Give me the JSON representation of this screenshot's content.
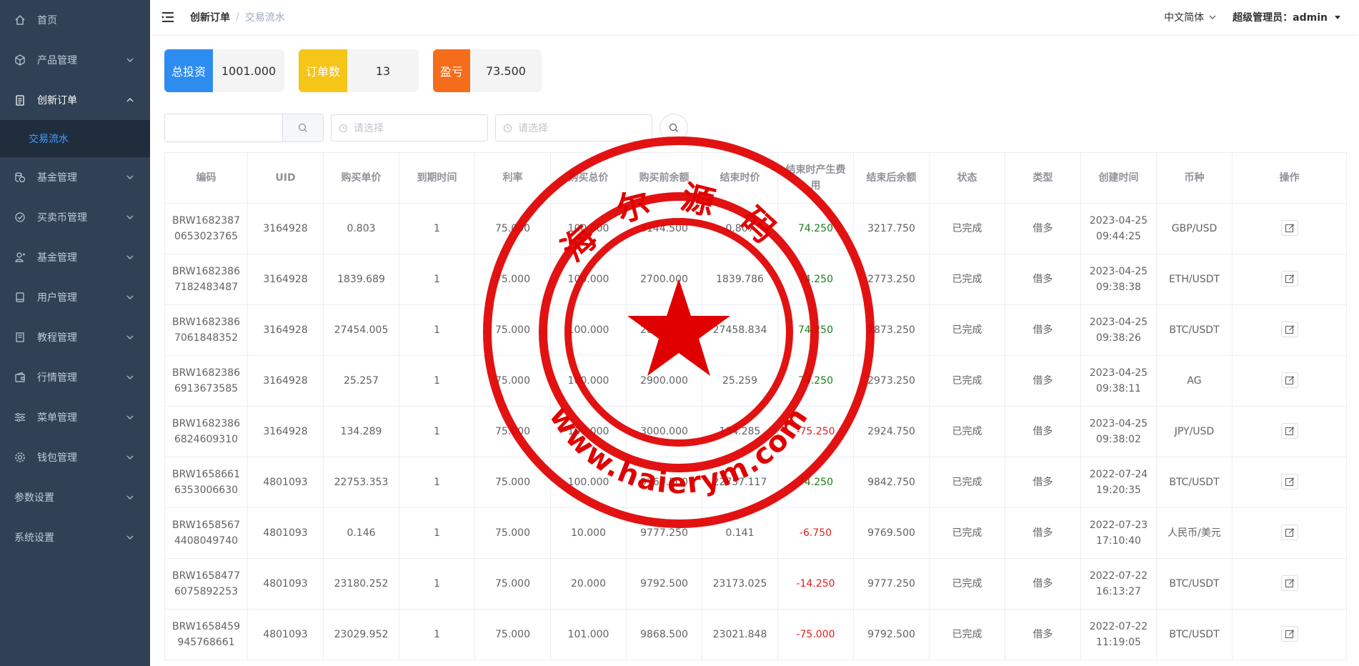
{
  "sidebar": {
    "items": [
      {
        "label": "首页",
        "icon": "home-icon",
        "chevron": false
      },
      {
        "label": "产品管理",
        "icon": "cube-icon",
        "chevron": true
      },
      {
        "label": "创新订单",
        "icon": "clipboard-icon",
        "chevron": true,
        "open": true
      },
      {
        "label": "基金管理",
        "icon": "coins-icon",
        "chevron": true
      },
      {
        "label": "买卖币管理",
        "icon": "exchange-icon",
        "chevron": true
      },
      {
        "label": "基金管理",
        "icon": "user-plus-icon",
        "chevron": true
      },
      {
        "label": "用户管理",
        "icon": "device-icon",
        "chevron": true
      },
      {
        "label": "教程管理",
        "icon": "book-icon",
        "chevron": true
      },
      {
        "label": "行情管理",
        "icon": "wallet-icon",
        "chevron": true
      },
      {
        "label": "菜单管理",
        "icon": "sliders-icon",
        "chevron": true
      },
      {
        "label": "钱包管理",
        "icon": "gear-icon",
        "chevron": true
      },
      {
        "label": "参数设置",
        "icon": "",
        "chevron": true
      },
      {
        "label": "系统设置",
        "icon": "",
        "chevron": true
      }
    ],
    "sub_item": "交易流水"
  },
  "header": {
    "breadcrumb_1": "创新订单",
    "breadcrumb_sep": "/",
    "breadcrumb_2": "交易流水",
    "language": "中文简体",
    "user": "超级管理员：admin"
  },
  "stats": [
    {
      "label": "总投资",
      "value": "1001.000",
      "color": "#2d8cf0"
    },
    {
      "label": "订单数",
      "value": "13",
      "color": "#f5c518"
    },
    {
      "label": "盈亏",
      "value": "73.500",
      "color": "#f56c1a"
    }
  ],
  "filters": {
    "search_value": "",
    "start_placeholder": "请选择",
    "end_placeholder": "请选择"
  },
  "table": {
    "columns": [
      "编码",
      "UID",
      "购买单价",
      "到期时间",
      "利率",
      "购买总价",
      "购买前余额",
      "结束时价",
      "结束时产生费用",
      "结束后余额",
      "状态",
      "类型",
      "创建时间",
      "币种",
      "操作"
    ],
    "rows": [
      {
        "code": "BRW16823870653023765",
        "uid": "3164928",
        "price": "0.803",
        "expire": "1",
        "rate": "75.000",
        "total": "100.000",
        "before": "3144.500",
        "end_price": "0.807",
        "fee": "74.250",
        "fee_sign": "pos",
        "after": "3217.750",
        "status": "已完成",
        "type": "借多",
        "created": "2023-04-25 09:44:25",
        "currency": "GBP/USD"
      },
      {
        "code": "BRW16823867182483487",
        "uid": "3164928",
        "price": "1839.689",
        "expire": "1",
        "rate": "75.000",
        "total": "100.000",
        "before": "2700.000",
        "end_price": "1839.786",
        "fee": "74.250",
        "fee_sign": "pos",
        "after": "2773.250",
        "status": "已完成",
        "type": "借多",
        "created": "2023-04-25 09:38:38",
        "currency": "ETH/USDT"
      },
      {
        "code": "BRW16823867061848352",
        "uid": "3164928",
        "price": "27454.005",
        "expire": "1",
        "rate": "75.000",
        "total": "100.000",
        "before": "2800.000",
        "end_price": "27458.834",
        "fee": "74.250",
        "fee_sign": "pos",
        "after": "2873.250",
        "status": "已完成",
        "type": "借多",
        "created": "2023-04-25 09:38:26",
        "currency": "BTC/USDT"
      },
      {
        "code": "BRW16823866913673585",
        "uid": "3164928",
        "price": "25.257",
        "expire": "1",
        "rate": "75.000",
        "total": "100.000",
        "before": "2900.000",
        "end_price": "25.259",
        "fee": "74.250",
        "fee_sign": "pos",
        "after": "2973.250",
        "status": "已完成",
        "type": "借多",
        "created": "2023-04-25 09:38:11",
        "currency": "AG"
      },
      {
        "code": "BRW16823866824609310",
        "uid": "3164928",
        "price": "134.289",
        "expire": "1",
        "rate": "75.000",
        "total": "100.000",
        "before": "3000.000",
        "end_price": "134.285",
        "fee": "-75.250",
        "fee_sign": "neg",
        "after": "2924.750",
        "status": "已完成",
        "type": "借多",
        "created": "2023-04-25 09:38:02",
        "currency": "JPY/USD"
      },
      {
        "code": "BRW16586616353006630",
        "uid": "4801093",
        "price": "22753.353",
        "expire": "1",
        "rate": "75.000",
        "total": "100.000",
        "before": "9769.500",
        "end_price": "22757.117",
        "fee": "74.250",
        "fee_sign": "pos",
        "after": "9842.750",
        "status": "已完成",
        "type": "借多",
        "created": "2022-07-24 19:20:35",
        "currency": "BTC/USDT"
      },
      {
        "code": "BRW16585674408049740",
        "uid": "4801093",
        "price": "0.146",
        "expire": "1",
        "rate": "75.000",
        "total": "10.000",
        "before": "9777.250",
        "end_price": "0.141",
        "fee": "-6.750",
        "fee_sign": "neg",
        "after": "9769.500",
        "status": "已完成",
        "type": "借多",
        "created": "2022-07-23 17:10:40",
        "currency": "人民币/美元"
      },
      {
        "code": "BRW16584776075892253",
        "uid": "4801093",
        "price": "23180.252",
        "expire": "1",
        "rate": "75.000",
        "total": "20.000",
        "before": "9792.500",
        "end_price": "23173.025",
        "fee": "-14.250",
        "fee_sign": "neg",
        "after": "9777.250",
        "status": "已完成",
        "type": "借多",
        "created": "2022-07-22 16:13:27",
        "currency": "BTC/USDT"
      },
      {
        "code": "BRW1658459945768661",
        "uid": "4801093",
        "price": "23029.952",
        "expire": "1",
        "rate": "75.000",
        "total": "101.000",
        "before": "9868.500",
        "end_price": "23021.848",
        "fee": "-75.000",
        "fee_sign": "neg",
        "after": "9792.500",
        "status": "已完成",
        "type": "借多",
        "created": "2022-07-22 11:19:05",
        "currency": "BTC/USDT"
      }
    ]
  },
  "watermark": {
    "top_text": "海尔源码",
    "bottom_text": "www.haierym.com",
    "color": "#e00000"
  }
}
